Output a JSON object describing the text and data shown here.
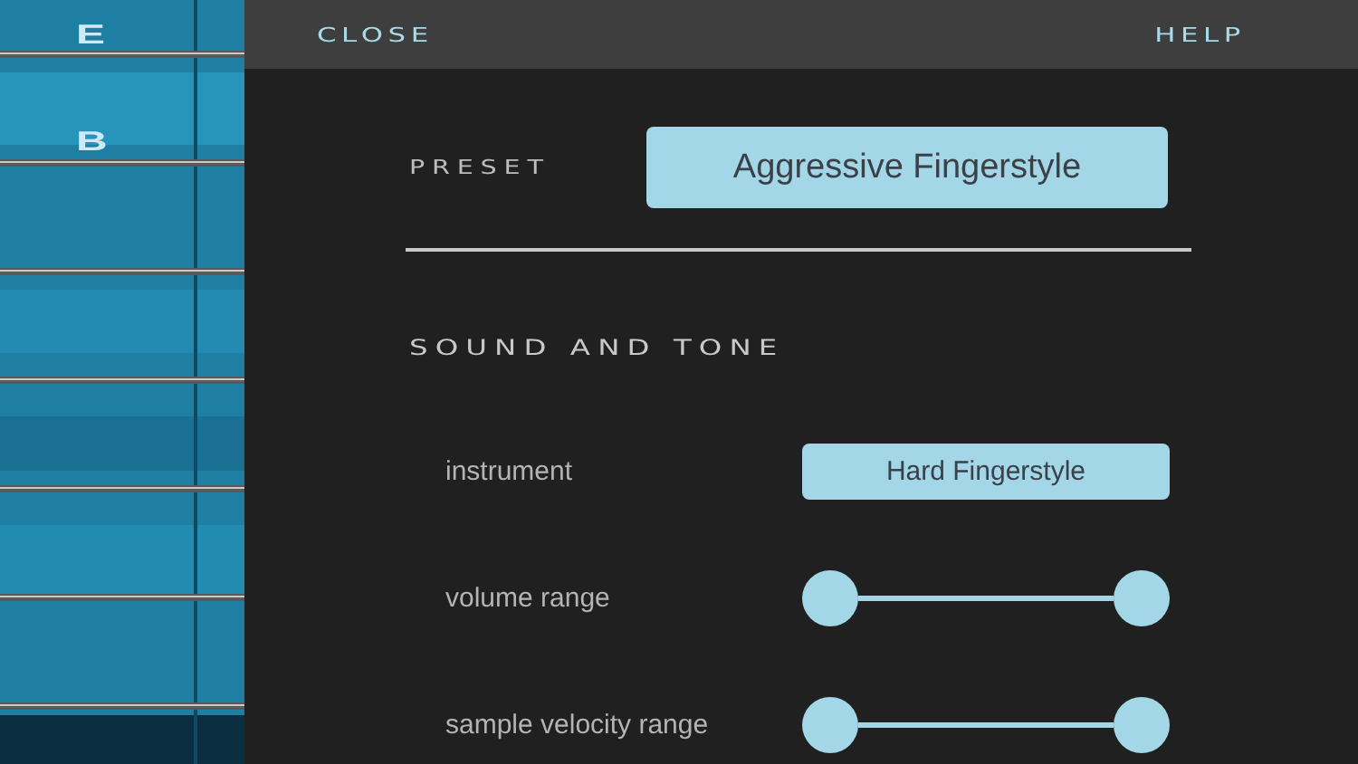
{
  "fretboard": {
    "kind": "picture",
    "string_labels": [
      "E",
      "B"
    ]
  },
  "top_bar": {
    "close": "CLOSE",
    "help": "HELP"
  },
  "preset": {
    "label": "PRESET",
    "value": "Aggressive Fingerstyle"
  },
  "section": {
    "title": "SOUND AND TONE",
    "rows": [
      {
        "kind": "select",
        "label": "instrument",
        "value": "Hard Fingerstyle"
      },
      {
        "kind": "range",
        "label": "volume range",
        "level": 1
      },
      {
        "kind": "range",
        "label": "sample velocity range",
        "level": 1
      }
    ]
  }
}
